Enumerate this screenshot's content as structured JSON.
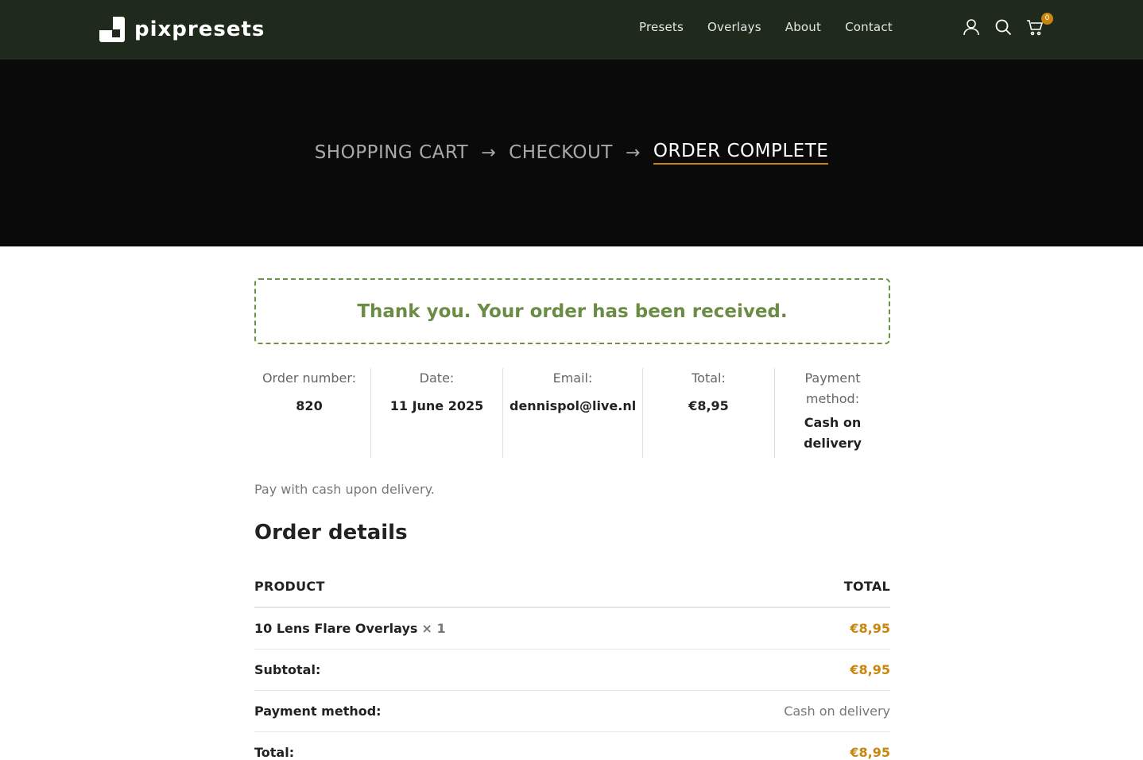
{
  "brand": {
    "name": "pixpresets"
  },
  "nav": {
    "items": [
      "Presets",
      "Overlays",
      "About",
      "Contact"
    ]
  },
  "header_icons": {
    "account": "user-icon",
    "search": "search-icon",
    "cart": "cart-icon",
    "cart_count": "0"
  },
  "steps": {
    "cart": "SHOPPING CART",
    "checkout": "CHECKOUT",
    "complete": "ORDER COMPLETE",
    "arrow": "→"
  },
  "notice": "Thank you. Your order has been received.",
  "overview": {
    "order_number_label": "Order number:",
    "order_number": "820",
    "date_label": "Date:",
    "date": "11 June 2025",
    "email_label": "Email:",
    "email": "dennispol@live.nl",
    "total_label": "Total:",
    "total": "€8,95",
    "payment_label": "Payment method:",
    "payment": "Cash on delivery"
  },
  "pay_note": "Pay with cash upon delivery.",
  "order_details": {
    "title": "Order details",
    "col_product": "PRODUCT",
    "col_total": "TOTAL",
    "item_name": "10 Lens Flare Overlays",
    "item_qty": "× 1",
    "item_total": "€8,95",
    "subtotal_label": "Subtotal:",
    "subtotal": "€8,95",
    "payment_label": "Payment method:",
    "payment": "Cash on delivery",
    "total_label": "Total:",
    "total": "€8,95"
  },
  "colors": {
    "header_bg": "#1f2a1d",
    "hero_bg": "#0a0a0a",
    "accent": "#c9860b",
    "success": "#6a8c44"
  }
}
